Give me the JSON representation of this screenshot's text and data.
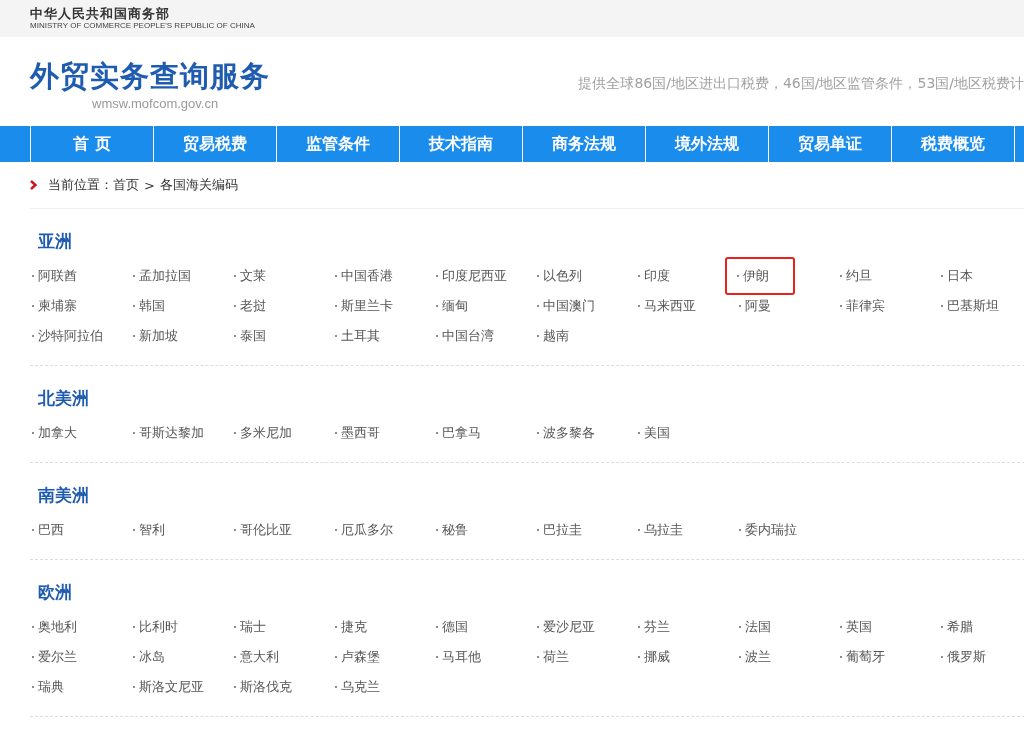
{
  "ministry": {
    "name": "中华人民共和国商务部",
    "english": "MINISTRY OF COMMERCE PEOPLE'S REPUBLIC OF CHINA"
  },
  "header": {
    "title": "外贸实务查询服务",
    "domain": "wmsw.mofcom.gov.cn",
    "slogan": "提供全球86国/地区进出口税费，46国/地区监管条件，53国/地区税费计"
  },
  "nav": [
    {
      "label": "首 页"
    },
    {
      "label": "贸易税费"
    },
    {
      "label": "监管条件"
    },
    {
      "label": "技术指南"
    },
    {
      "label": "商务法规"
    },
    {
      "label": "境外法规"
    },
    {
      "label": "贸易单证"
    },
    {
      "label": "税费概览"
    }
  ],
  "breadcrumb": {
    "label": "当前位置：",
    "home": "首页",
    "separator": ">",
    "current": "各国海关编码"
  },
  "regions": [
    {
      "name": "亚洲",
      "countries": [
        {
          "name": "阿联酋",
          "highlighted": false
        },
        {
          "name": "孟加拉国",
          "highlighted": false
        },
        {
          "name": "文莱",
          "highlighted": false
        },
        {
          "name": "中国香港",
          "highlighted": false
        },
        {
          "name": "印度尼西亚",
          "highlighted": false
        },
        {
          "name": "以色列",
          "highlighted": false
        },
        {
          "name": "印度",
          "highlighted": false
        },
        {
          "name": "伊朗",
          "highlighted": true
        },
        {
          "name": "约旦",
          "highlighted": false
        },
        {
          "name": "日本",
          "highlighted": false
        },
        {
          "name": "柬埔寨",
          "highlighted": false
        },
        {
          "name": "韩国",
          "highlighted": false
        },
        {
          "name": "老挝",
          "highlighted": false
        },
        {
          "name": "斯里兰卡",
          "highlighted": false
        },
        {
          "name": "缅甸",
          "highlighted": false
        },
        {
          "name": "中国澳门",
          "highlighted": false
        },
        {
          "name": "马来西亚",
          "highlighted": false
        },
        {
          "name": "阿曼",
          "highlighted": false
        },
        {
          "name": "菲律宾",
          "highlighted": false
        },
        {
          "name": "巴基斯坦",
          "highlighted": false
        },
        {
          "name": "沙特阿拉伯",
          "highlighted": false
        },
        {
          "name": "新加坡",
          "highlighted": false
        },
        {
          "name": "泰国",
          "highlighted": false
        },
        {
          "name": "土耳其",
          "highlighted": false
        },
        {
          "name": "中国台湾",
          "highlighted": false
        },
        {
          "name": "越南",
          "highlighted": false
        }
      ]
    },
    {
      "name": "北美洲",
      "countries": [
        {
          "name": "加拿大",
          "highlighted": false
        },
        {
          "name": "哥斯达黎加",
          "highlighted": false
        },
        {
          "name": "多米尼加",
          "highlighted": false
        },
        {
          "name": "墨西哥",
          "highlighted": false
        },
        {
          "name": "巴拿马",
          "highlighted": false
        },
        {
          "name": "波多黎各",
          "highlighted": false
        },
        {
          "name": "美国",
          "highlighted": false
        }
      ]
    },
    {
      "name": "南美洲",
      "countries": [
        {
          "name": "巴西",
          "highlighted": false
        },
        {
          "name": "智利",
          "highlighted": false
        },
        {
          "name": "哥伦比亚",
          "highlighted": false
        },
        {
          "name": "厄瓜多尔",
          "highlighted": false
        },
        {
          "name": "秘鲁",
          "highlighted": false
        },
        {
          "name": "巴拉圭",
          "highlighted": false
        },
        {
          "name": "乌拉圭",
          "highlighted": false
        },
        {
          "name": "委内瑞拉",
          "highlighted": false
        }
      ]
    },
    {
      "name": "欧洲",
      "countries": [
        {
          "name": "奥地利",
          "highlighted": false
        },
        {
          "name": "比利时",
          "highlighted": false
        },
        {
          "name": "瑞士",
          "highlighted": false
        },
        {
          "name": "捷克",
          "highlighted": false
        },
        {
          "name": "德国",
          "highlighted": false
        },
        {
          "name": "爱沙尼亚",
          "highlighted": false
        },
        {
          "name": "芬兰",
          "highlighted": false
        },
        {
          "name": "法国",
          "highlighted": false
        },
        {
          "name": "英国",
          "highlighted": false
        },
        {
          "name": "希腊",
          "highlighted": false
        },
        {
          "name": "爱尔兰",
          "highlighted": false
        },
        {
          "name": "冰岛",
          "highlighted": false
        },
        {
          "name": "意大利",
          "highlighted": false
        },
        {
          "name": "卢森堡",
          "highlighted": false
        },
        {
          "name": "马耳他",
          "highlighted": false
        },
        {
          "name": "荷兰",
          "highlighted": false
        },
        {
          "name": "挪威",
          "highlighted": false
        },
        {
          "name": "波兰",
          "highlighted": false
        },
        {
          "name": "葡萄牙",
          "highlighted": false
        },
        {
          "name": "俄罗斯",
          "highlighted": false
        },
        {
          "name": "瑞典",
          "highlighted": false
        },
        {
          "name": "斯洛文尼亚",
          "highlighted": false
        },
        {
          "name": "斯洛伐克",
          "highlighted": false
        },
        {
          "name": "乌克兰",
          "highlighted": false
        }
      ]
    }
  ]
}
